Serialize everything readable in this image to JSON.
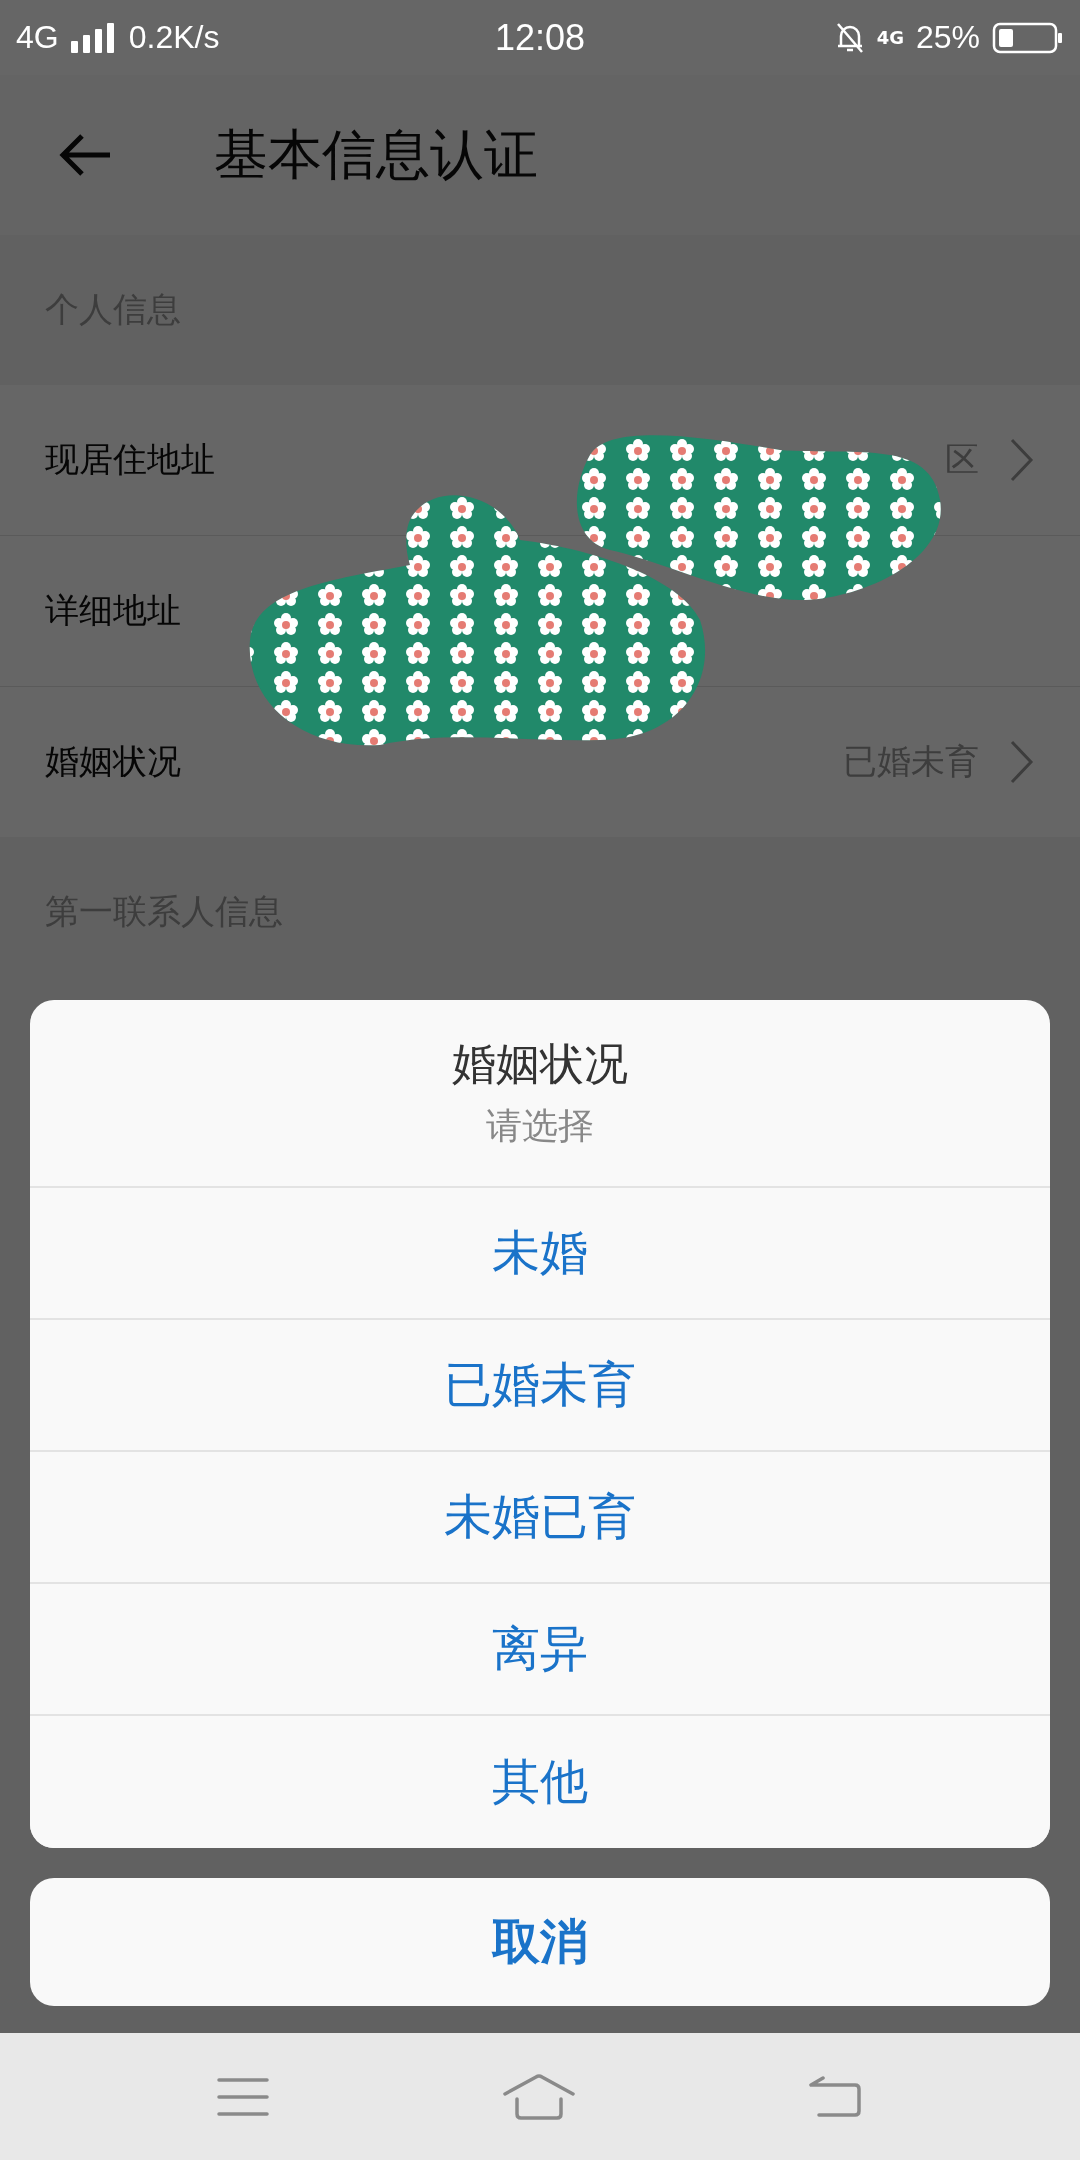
{
  "status_bar": {
    "network": "4G",
    "speed": "0.2K/s",
    "time": "12:08",
    "data_type": "4G",
    "battery": "25%"
  },
  "header": {
    "title": "基本信息认证"
  },
  "sections": [
    {
      "title": "个人信息",
      "rows": [
        {
          "label": "现居住地址",
          "value": "区",
          "arrow": true
        },
        {
          "label": "详细地址",
          "arrow": false
        },
        {
          "label": "婚姻状况",
          "value": "已婚未育",
          "arrow": true
        }
      ]
    },
    {
      "title": "第一联系人信息"
    }
  ],
  "action_sheet": {
    "title": "婚姻状况",
    "subtitle": "请选择",
    "options": [
      "未婚",
      "已婚未育",
      "未婚已育",
      "离异",
      "其他"
    ],
    "cancel": "取消"
  }
}
